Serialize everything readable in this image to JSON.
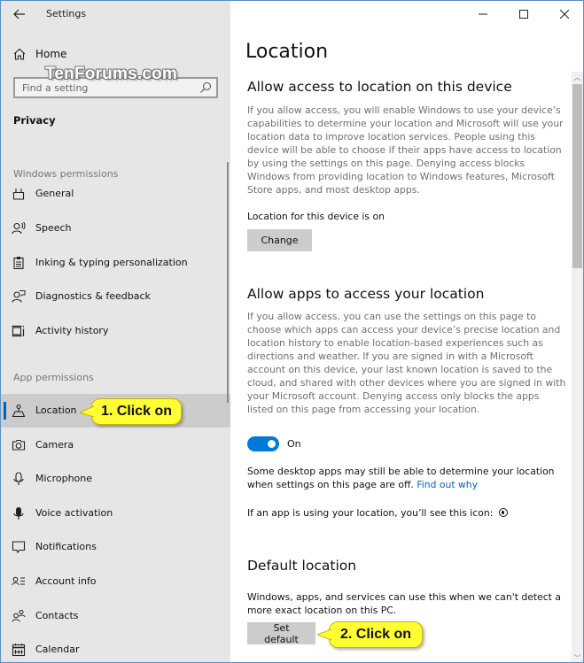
{
  "window": {
    "app_title": "Settings",
    "controls": {
      "minimize": "–",
      "maximize": "☐",
      "close": "✕"
    }
  },
  "sidebar": {
    "home_label": "Home",
    "watermark": "TenForums.com",
    "search": {
      "placeholder": "Find a setting",
      "value": ""
    },
    "section_title": "Privacy",
    "windows_permissions_label": "Windows permissions",
    "windows_permissions": [
      {
        "label": "General",
        "icon": "lock-icon"
      },
      {
        "label": "Speech",
        "icon": "speech-icon"
      },
      {
        "label": "Inking & typing personalization",
        "icon": "clipboard-icon"
      },
      {
        "label": "Diagnostics & feedback",
        "icon": "feedback-icon"
      },
      {
        "label": "Activity history",
        "icon": "timeline-icon"
      }
    ],
    "app_permissions_label": "App permissions",
    "app_permissions": [
      {
        "label": "Location",
        "icon": "location-icon",
        "selected": true
      },
      {
        "label": "Camera",
        "icon": "camera-icon"
      },
      {
        "label": "Microphone",
        "icon": "microphone-icon"
      },
      {
        "label": "Voice activation",
        "icon": "voice-activation-icon"
      },
      {
        "label": "Notifications",
        "icon": "notification-icon"
      },
      {
        "label": "Account info",
        "icon": "account-info-icon"
      },
      {
        "label": "Contacts",
        "icon": "contacts-icon"
      },
      {
        "label": "Calendar",
        "icon": "calendar-icon"
      }
    ]
  },
  "callouts": {
    "step1": "1. Click on",
    "step2": "2. Click on"
  },
  "main": {
    "page_title": "Location",
    "device_section": {
      "heading": "Allow access to location on this device",
      "description": "If you allow access, you will enable Windows to use your device’s capabilities to determine your location and Microsoft will use your location data to improve location services. People using this device will be able to choose if their apps have access to location by using the settings on this page. Denying access blocks Windows from providing location to Windows features, Microsoft Store apps, and most desktop apps.",
      "status": "Location for this device is on",
      "change_button": "Change"
    },
    "apps_section": {
      "heading": "Allow apps to access your location",
      "description": "If you allow access, you can use the settings on this page to choose which apps can access your device’s precise location and location history to enable location-based experiences such as directions and weather. If you are signed in with a Microsoft account on this device, your last known location is saved to the cloud, and shared with other devices where you are signed in with your Microsoft account. Denying access only blocks the apps listed on this page from accessing your location.",
      "toggle_state": "On",
      "toggle_on": true,
      "note": "Some desktop apps may still be able to determine your location when settings on this page are off.",
      "note_link": "Find out why",
      "icon_note": "If an app is using your location, you’ll see this icon:"
    },
    "default_section": {
      "heading": "Default location",
      "description": "Windows, apps, and services can use this when we can't detect a more exact location on this PC.",
      "set_default_button": "Set default"
    }
  },
  "colors": {
    "accent": "#0078d7",
    "link": "#0067b8",
    "sidebar_bg": "#e6e6e6",
    "selected_bg": "#cccccc",
    "callout_bg": "#ffff33"
  }
}
